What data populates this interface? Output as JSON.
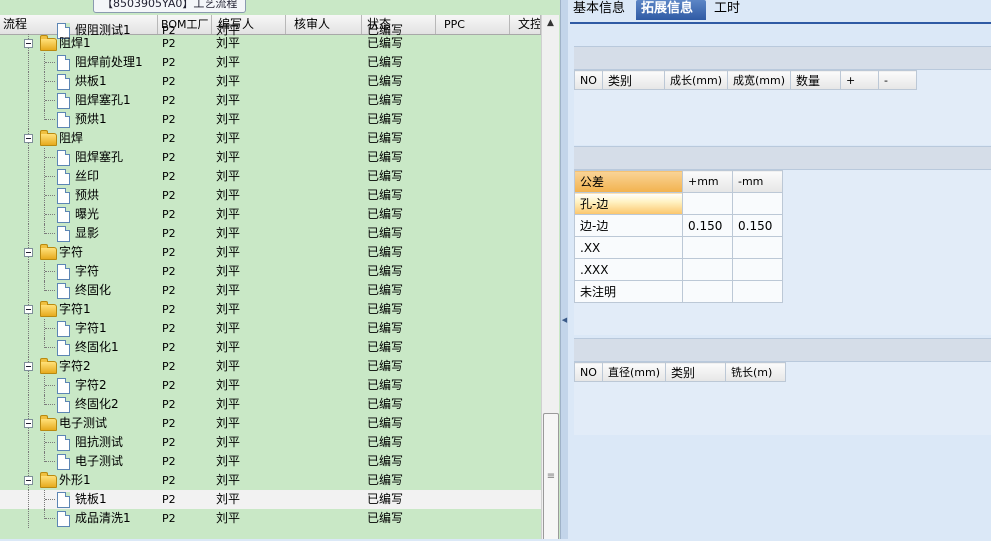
{
  "window_tab": "【8503905YA0】工艺流程",
  "left_grid": {
    "columns": [
      "流程",
      "BOM工厂",
      "编写人",
      "核审人",
      "状态",
      "PPC",
      "文控"
    ],
    "partial_top": {
      "label": "假阻测试1",
      "bom": "P2",
      "editor": "刘平",
      "status": "已编写"
    },
    "rows": [
      {
        "label": "阻焊1",
        "type": "folder",
        "bom": "P2",
        "editor": "刘平",
        "status": "已编写"
      },
      {
        "label": "阻焊前处理1",
        "type": "doc",
        "bom": "P2",
        "editor": "刘平",
        "status": "已编写"
      },
      {
        "label": "烘板1",
        "type": "doc",
        "bom": "P2",
        "editor": "刘平",
        "status": "已编写"
      },
      {
        "label": "阻焊塞孔1",
        "type": "doc",
        "bom": "P2",
        "editor": "刘平",
        "status": "已编写"
      },
      {
        "label": "预烘1",
        "type": "doc",
        "bom": "P2",
        "editor": "刘平",
        "status": "已编写"
      },
      {
        "label": "阻焊",
        "type": "folder",
        "bom": "P2",
        "editor": "刘平",
        "status": "已编写"
      },
      {
        "label": "阻焊塞孔",
        "type": "doc",
        "bom": "P2",
        "editor": "刘平",
        "status": "已编写"
      },
      {
        "label": "丝印",
        "type": "doc",
        "bom": "P2",
        "editor": "刘平",
        "status": "已编写"
      },
      {
        "label": "预烘",
        "type": "doc",
        "bom": "P2",
        "editor": "刘平",
        "status": "已编写"
      },
      {
        "label": "曝光",
        "type": "doc",
        "bom": "P2",
        "editor": "刘平",
        "status": "已编写"
      },
      {
        "label": "显影",
        "type": "doc",
        "bom": "P2",
        "editor": "刘平",
        "status": "已编写"
      },
      {
        "label": "字符",
        "type": "folder",
        "bom": "P2",
        "editor": "刘平",
        "status": "已编写"
      },
      {
        "label": "字符",
        "type": "doc",
        "bom": "P2",
        "editor": "刘平",
        "status": "已编写"
      },
      {
        "label": "终固化",
        "type": "doc",
        "bom": "P2",
        "editor": "刘平",
        "status": "已编写"
      },
      {
        "label": "字符1",
        "type": "folder",
        "bom": "P2",
        "editor": "刘平",
        "status": "已编写"
      },
      {
        "label": "字符1",
        "type": "doc",
        "bom": "P2",
        "editor": "刘平",
        "status": "已编写"
      },
      {
        "label": "终固化1",
        "type": "doc",
        "bom": "P2",
        "editor": "刘平",
        "status": "已编写"
      },
      {
        "label": "字符2",
        "type": "folder",
        "bom": "P2",
        "editor": "刘平",
        "status": "已编写"
      },
      {
        "label": "字符2",
        "type": "doc",
        "bom": "P2",
        "editor": "刘平",
        "status": "已编写"
      },
      {
        "label": "终固化2",
        "type": "doc",
        "bom": "P2",
        "editor": "刘平",
        "status": "已编写"
      },
      {
        "label": "电子测试",
        "type": "folder",
        "bom": "P2",
        "editor": "刘平",
        "status": "已编写"
      },
      {
        "label": "阻抗测试",
        "type": "doc",
        "bom": "P2",
        "editor": "刘平",
        "status": "已编写"
      },
      {
        "label": "电子测试",
        "type": "doc",
        "bom": "P2",
        "editor": "刘平",
        "status": "已编写"
      },
      {
        "label": "外形1",
        "type": "folder",
        "bom": "P2",
        "editor": "刘平",
        "status": "已编写"
      },
      {
        "label": "铣板1",
        "type": "doc",
        "bom": "P2",
        "editor": "刘平",
        "status": "已编写",
        "selected": true
      },
      {
        "label": "成品清洗1",
        "type": "doc",
        "bom": "P2",
        "editor": "刘平",
        "status": "已编写"
      }
    ]
  },
  "right_panel": {
    "tabs": [
      {
        "label": "基本信息",
        "active": false
      },
      {
        "label": "拓展信息",
        "active": true
      },
      {
        "label": "工时",
        "active": false
      }
    ],
    "size_table": {
      "headers": [
        "NO",
        "类别",
        "成长(mm)",
        "成宽(mm)",
        "数量",
        "+",
        "-"
      ]
    },
    "tolerance_table": {
      "headers": [
        "公差",
        "+mm",
        "-mm"
      ],
      "rows": [
        {
          "label": "孔-边",
          "plus": "",
          "minus": ""
        },
        {
          "label": "边-边",
          "plus": "0.150",
          "minus": "0.150"
        },
        {
          "label": ".XX",
          "plus": "",
          "minus": ""
        },
        {
          "label": ".XXX",
          "plus": "",
          "minus": ""
        },
        {
          "label": "未注明",
          "plus": "",
          "minus": ""
        }
      ]
    },
    "mill_table": {
      "headers": [
        "NO",
        "直径(mm)",
        "类别",
        "铣长(m)"
      ]
    }
  },
  "icons": {
    "scroll_up": "▲",
    "thumb_grip": "≡",
    "splitter_arrow": "◀"
  }
}
